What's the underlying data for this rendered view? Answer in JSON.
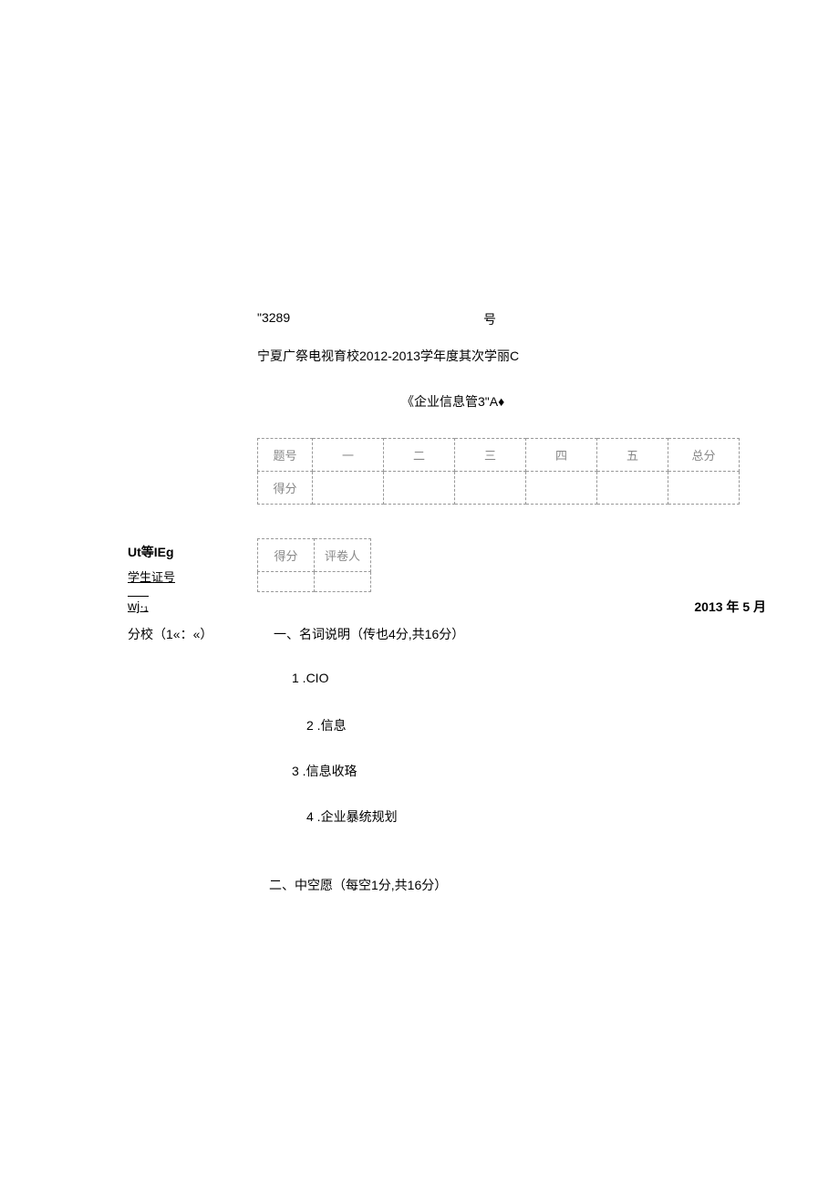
{
  "header": {
    "exam_number_prefix": "\"3289",
    "hao": "号",
    "school_line": "宁夏广祭电视育校2012-2013学年度其次学丽C",
    "course_title": "《企业信息管3\"A♦"
  },
  "score_table": {
    "headers": [
      "题号",
      "一",
      "二",
      "三",
      "四",
      "五",
      "总分"
    ],
    "row_label": "得分"
  },
  "sidebar": {
    "label1": "Ut等IEg",
    "label2": "学生证号",
    "label3": "wj·₁",
    "label4": "分校（1«：«）"
  },
  "grader_table": {
    "score_label": "得分",
    "grader_label": "评卷人"
  },
  "date": "2013 年 5 月",
  "section1": {
    "title": "一、名词说明（传也4分,共16分）",
    "items": [
      "1  .CIO",
      "2  .信息",
      "3  .信息收珞",
      "4  .企业暴统规划"
    ]
  },
  "section2": {
    "title": "二、中空愿（每空1分,共16分）"
  }
}
